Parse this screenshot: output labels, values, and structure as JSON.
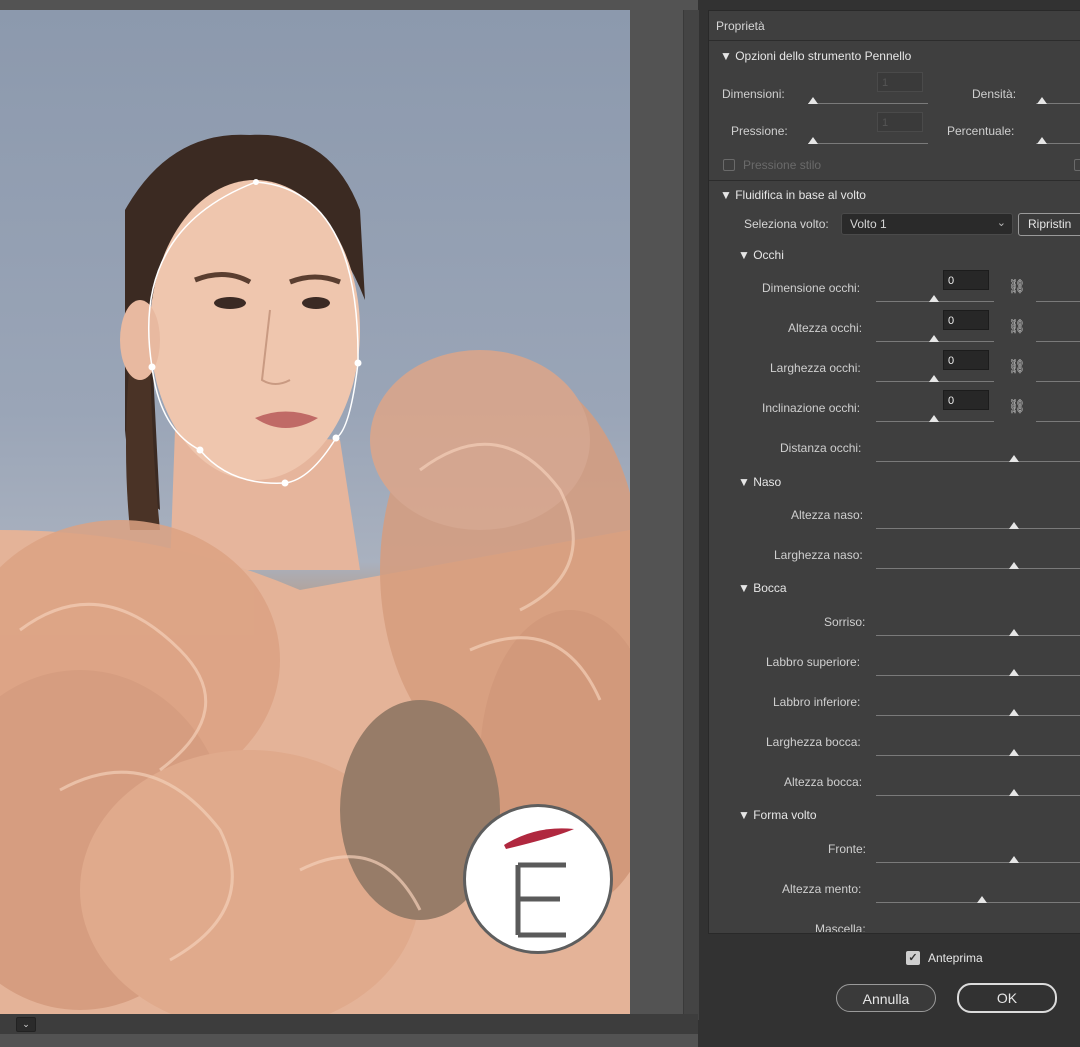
{
  "panel": {
    "title": "Proprietà",
    "brush": {
      "section": "▼ Opzioni dello strumento Pennello",
      "dimensioni_label": "Dimensioni:",
      "dimensioni_value": "1",
      "densita_label": "Densità:",
      "pressione_label": "Pressione:",
      "pressione_value": "1",
      "percentuale_label": "Percentuale:",
      "pressione_stilo_label": "Pressione stilo"
    },
    "face": {
      "section": "▼ Fluidifica in base al volto",
      "select_label": "Seleziona volto:",
      "select_value": "Volto 1",
      "reset_label": "Ripristin",
      "eyes": {
        "section": "▼ Occhi",
        "rows": [
          {
            "label": "Dimensione occhi:",
            "value": "0"
          },
          {
            "label": "Altezza occhi:",
            "value": "0"
          },
          {
            "label": "Larghezza occhi:",
            "value": "0"
          },
          {
            "label": "Inclinazione occhi:",
            "value": "0"
          }
        ],
        "distance_label": "Distanza occhi:"
      },
      "nose": {
        "section": "▼ Naso",
        "height_label": "Altezza naso:",
        "width_label": "Larghezza naso:"
      },
      "mouth": {
        "section": "▼ Bocca",
        "smile_label": "Sorriso:",
        "upper_lip_label": "Labbro superiore:",
        "lower_lip_label": "Labbro inferiore:",
        "width_label": "Larghezza bocca:",
        "height_label": "Altezza bocca:"
      },
      "shape": {
        "section": "▼ Forma volto",
        "forehead_label": "Fronte:",
        "chin_label": "Altezza mento:",
        "jaw_label": "Mascella:"
      }
    }
  },
  "footer": {
    "preview_label": "Anteprima",
    "preview_checked": "✓",
    "cancel_label": "Annulla",
    "ok_label": "OK"
  },
  "canvas": {
    "zoom_dropdown": "⌄",
    "logo_letter": "E"
  },
  "colors": {
    "accent": "#b0283f",
    "panel_bg": "#3f3f3f",
    "app_bg": "#323232"
  }
}
